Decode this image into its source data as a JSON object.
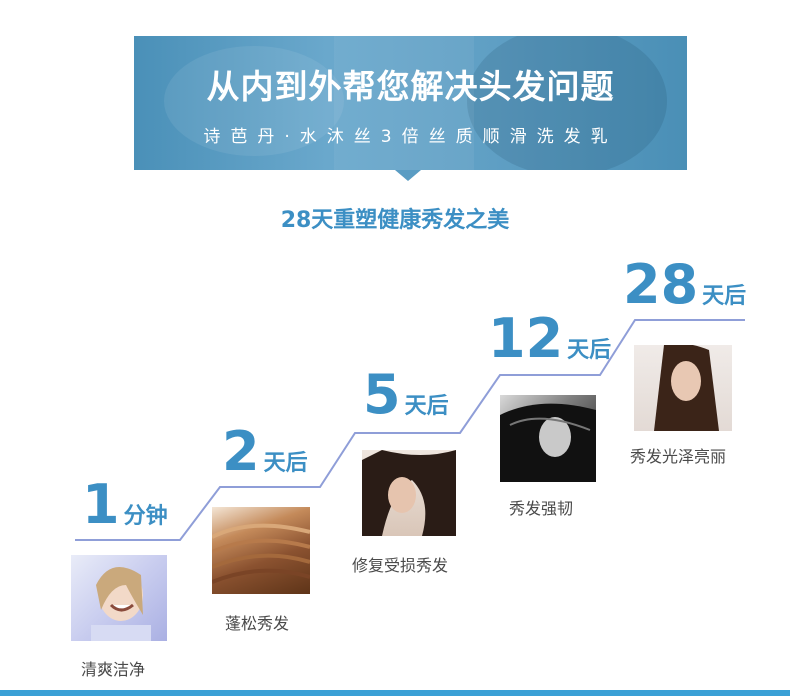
{
  "banner": {
    "title": "从内到外帮您解决头发问题",
    "subtitle": "诗芭丹·水沐丝3倍丝质顺滑洗发乳"
  },
  "headline": "28天重塑健康秀发之美",
  "colors": {
    "accent": "#3c8fc4",
    "banner": "#5a9cc3",
    "stair_line": "#8f9ed8",
    "bottom_bar": "#3aa0d6"
  },
  "steps": [
    {
      "num": "1",
      "unit": "分钟",
      "caption": "清爽洁净",
      "image": "smiling-woman-photo"
    },
    {
      "num": "2",
      "unit": "天后",
      "caption": "蓬松秀发",
      "image": "brown-hair-photo"
    },
    {
      "num": "5",
      "unit": "天后",
      "caption": "修复受损秀发",
      "image": "windblown-hair-photo"
    },
    {
      "num": "12",
      "unit": "天后",
      "caption": "秀发强韧",
      "image": "black-white-hair-photo"
    },
    {
      "num": "28",
      "unit": "天后",
      "caption": "秀发光泽亮丽",
      "image": "long-hair-woman-photo"
    }
  ]
}
